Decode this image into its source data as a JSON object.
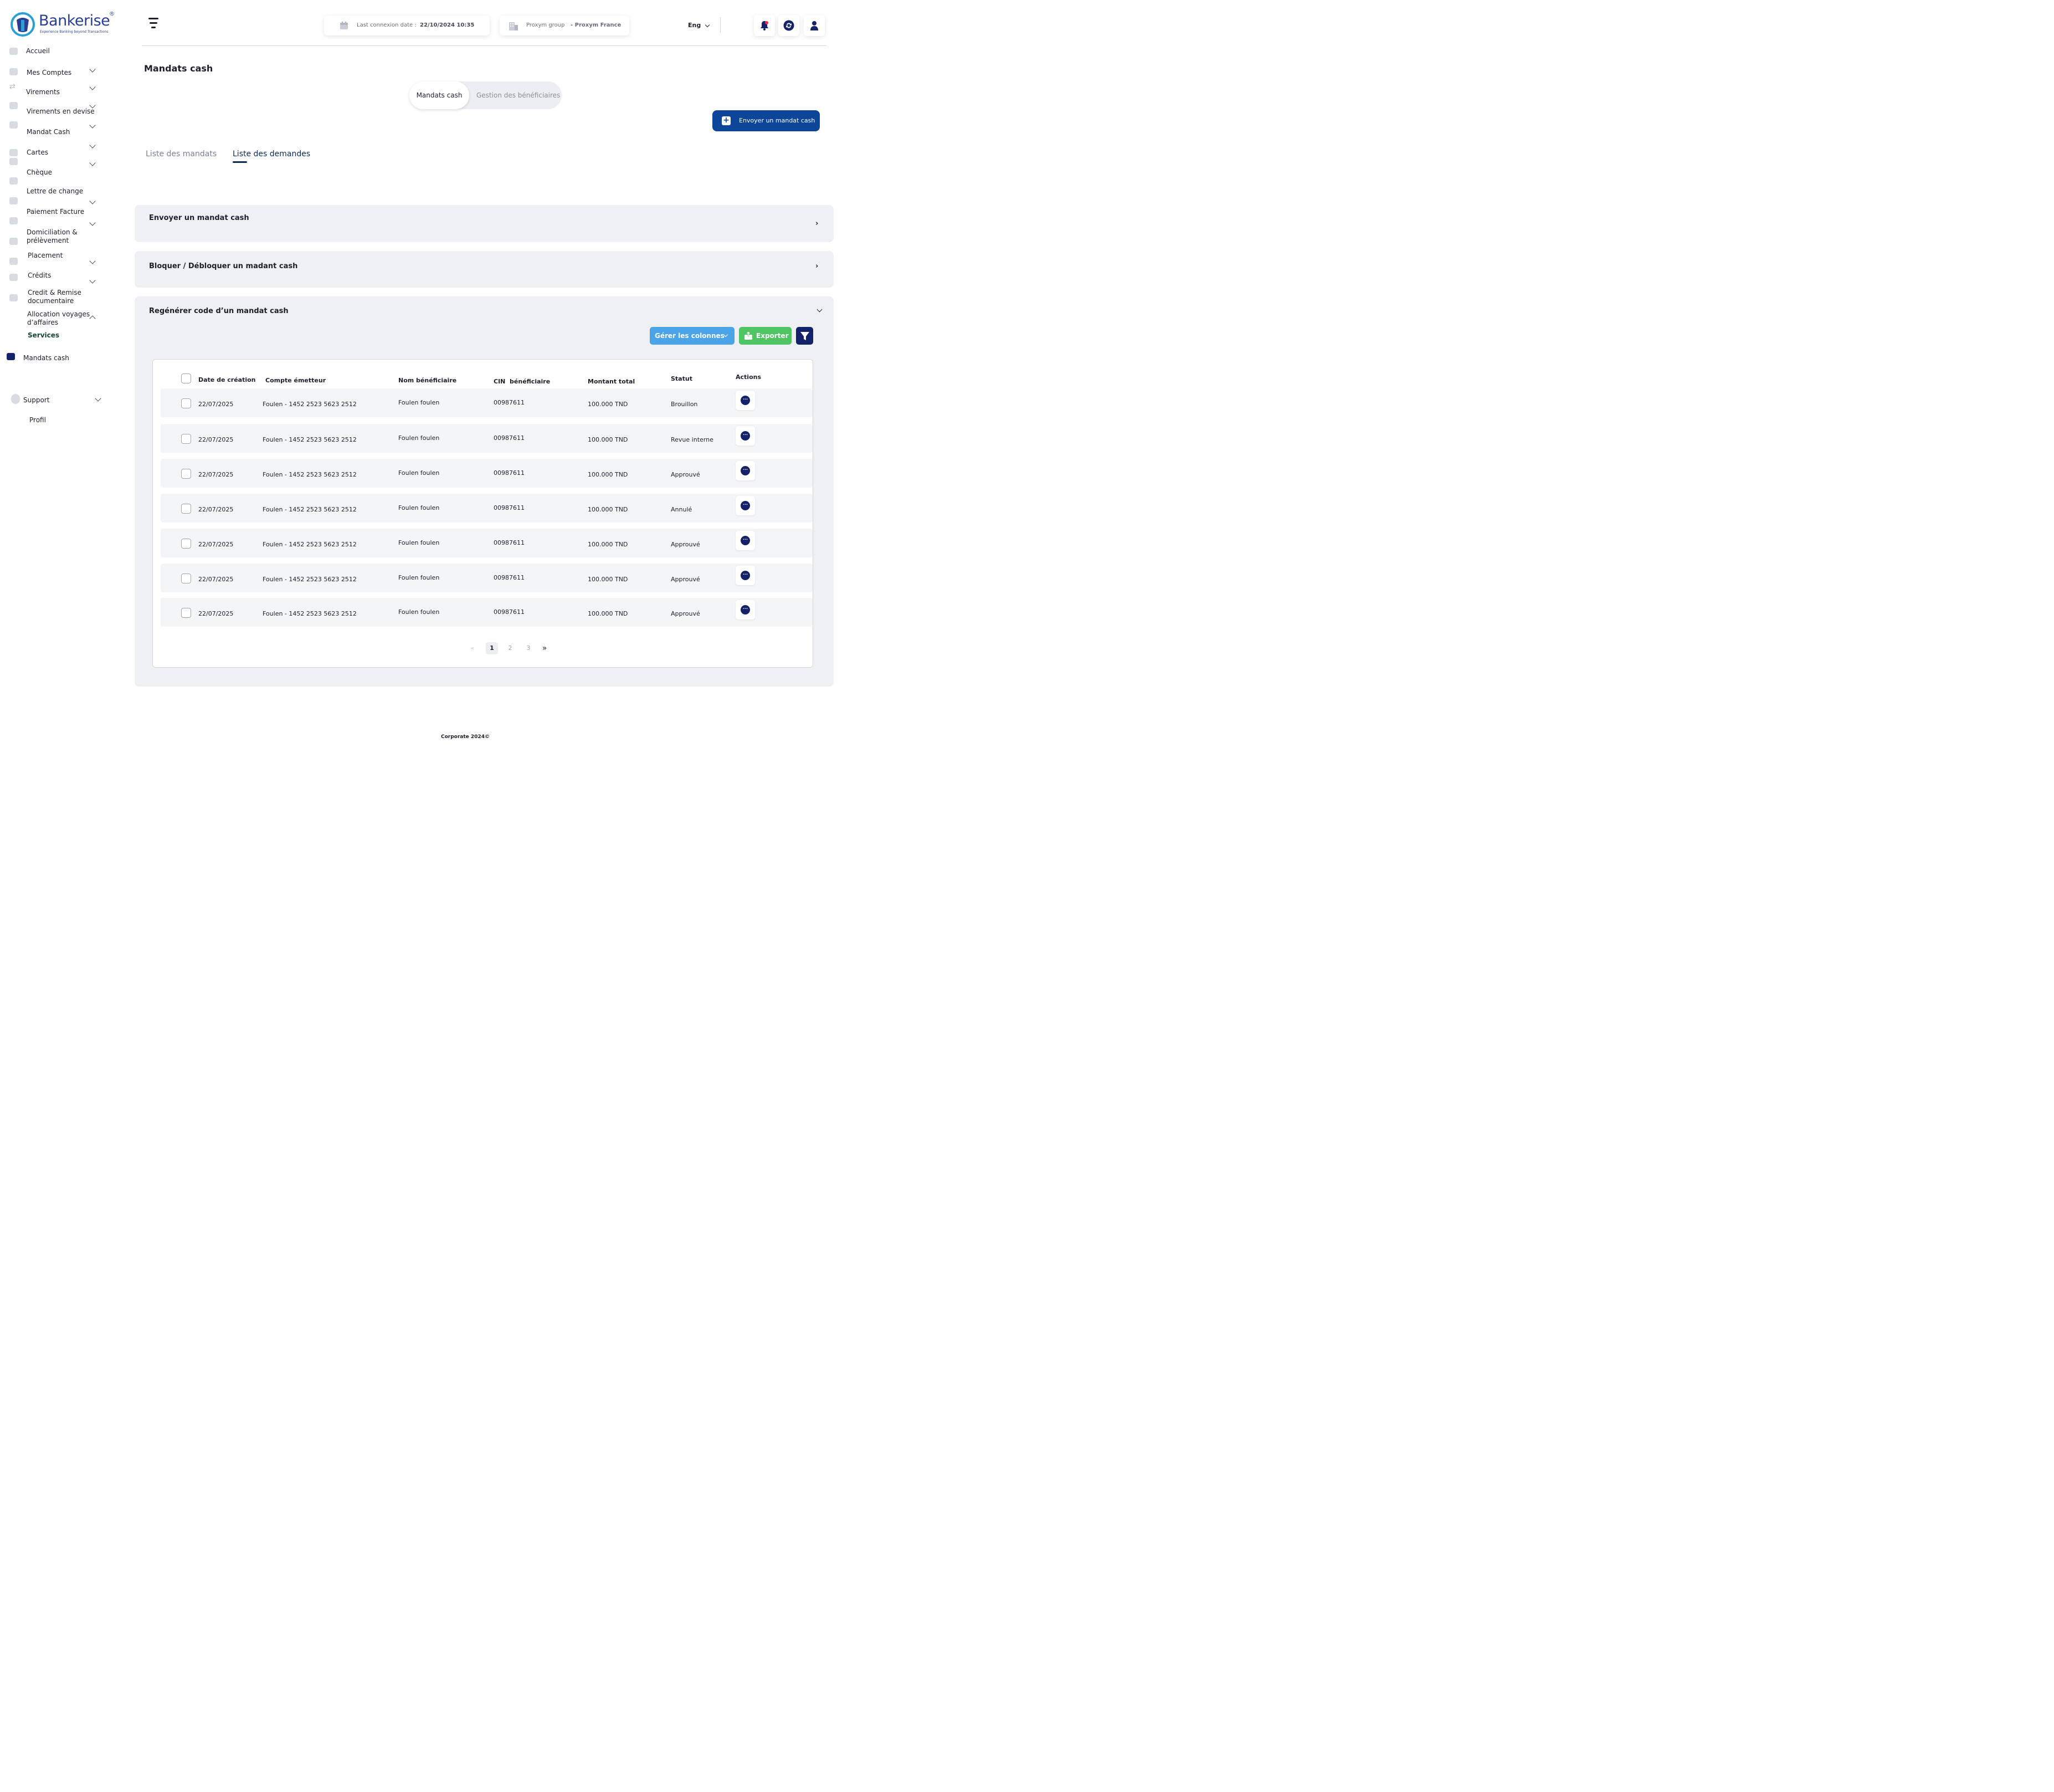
{
  "brand": {
    "name": "Bankerise",
    "tagline": "Experience Banking beyond Transactions",
    "registered": "®"
  },
  "sidebar": {
    "items": [
      {
        "label": "Accueil",
        "icon": "home-icon",
        "chevron": false
      },
      {
        "label": "Mes Comptes",
        "icon": "folder-icon",
        "chevron": true
      },
      {
        "label": "Virements",
        "icon": "transfer-icon",
        "chevron": true
      },
      {
        "label": "Virements en devise",
        "icon": "currency-icon",
        "chevron": true
      },
      {
        "label": "Mandat Cash",
        "icon": "mail-icon",
        "chevron": true
      },
      {
        "label": "Cartes",
        "icon": "card-icon",
        "chevron": true
      },
      {
        "label": "Chèque",
        "icon": "cheque-icon",
        "chevron": true
      },
      {
        "label": "Lettre de change",
        "icon": "mail-icon",
        "chevron": false
      },
      {
        "label": "Paiement Facture",
        "icon": "invoice-icon",
        "chevron": true
      },
      {
        "label": "Domiciliation & prélèvement",
        "icon": "mail-icon",
        "chevron": true
      },
      {
        "label": "Placement",
        "icon": "chart-icon",
        "chevron": true
      },
      {
        "label": "Crédits",
        "icon": "mail-icon",
        "chevron": true
      },
      {
        "label": "Credit & Remise documentaire",
        "icon": "mail-icon",
        "chevron": false
      },
      {
        "label": "Allocation  voyages d’affaires",
        "icon": "mail-icon",
        "chevron": "up"
      }
    ],
    "section_label": "Services",
    "active_item": "Mandats cash",
    "support": "Support",
    "profile": "Profil"
  },
  "header": {
    "last_connexion_label": "Last connexion date :",
    "last_connexion_value": "22/10/2024 10:35",
    "group_label": "Proxym group",
    "group_value": "- Proxym France",
    "language": "Eng"
  },
  "page": {
    "title": "Mandats cash",
    "segment": {
      "active": "Mandats cash",
      "inactive": "Gestion des bénéficiaires"
    },
    "primary_button": "Envoyer un mandat cash",
    "tabs": [
      {
        "label": "Liste des mandats",
        "active": false
      },
      {
        "label": "Liste des demandes",
        "active": true
      }
    ]
  },
  "accordions": [
    {
      "title": "Envoyer un mandat cash",
      "expanded": false
    },
    {
      "title": "Bloquer / Débloquer un madant cash",
      "expanded": false
    },
    {
      "title": "Regénérer code d’un mandat cash",
      "expanded": true
    }
  ],
  "toolbar": {
    "columns_button": "Gérer les colonnes",
    "export_button": "Exporter",
    "filter_icon": "filter-icon"
  },
  "table": {
    "columns": [
      "Date de création",
      "Compte émetteur",
      "Nom bénéficiaire",
      "CIN  bénéficiaire",
      "Montant total",
      "Statut",
      "Actions"
    ],
    "rows": [
      {
        "date": "22/07/2025",
        "compte": "Foulen - 1452 2523 5623 2512",
        "nom": "Foulen foulen",
        "cin": "00987611",
        "montant": "100.000 TND",
        "statut": "Brouillon"
      },
      {
        "date": "22/07/2025",
        "compte": "Foulen - 1452 2523 5623 2512",
        "nom": "Foulen foulen",
        "cin": "00987611",
        "montant": "100.000 TND",
        "statut": "Revue interne"
      },
      {
        "date": "22/07/2025",
        "compte": "Foulen - 1452 2523 5623 2512",
        "nom": "Foulen foulen",
        "cin": "00987611",
        "montant": "100.000 TND",
        "statut": "Approuvé"
      },
      {
        "date": "22/07/2025",
        "compte": "Foulen - 1452 2523 5623 2512",
        "nom": "Foulen foulen",
        "cin": "00987611",
        "montant": "100.000 TND",
        "statut": "Annulé"
      },
      {
        "date": "22/07/2025",
        "compte": "Foulen - 1452 2523 5623 2512",
        "nom": "Foulen foulen",
        "cin": "00987611",
        "montant": "100.000 TND",
        "statut": "Approuvé"
      },
      {
        "date": "22/07/2025",
        "compte": "Foulen - 1452 2523 5623 2512",
        "nom": "Foulen foulen",
        "cin": "00987611",
        "montant": "100.000 TND",
        "statut": "Approuvé"
      },
      {
        "date": "22/07/2025",
        "compte": "Foulen - 1452 2523 5623 2512",
        "nom": "Foulen foulen",
        "cin": "00987611",
        "montant": "100.000 TND",
        "statut": "Approuvé"
      }
    ]
  },
  "pagination": {
    "first": "«",
    "pages": [
      "1",
      "2",
      "3"
    ],
    "current": "1",
    "next": "»"
  },
  "footer": "Corporate 2024©",
  "colors": {
    "primary": "#0d4699",
    "navy": "#14226b",
    "columns_btn": "#4ba4e8",
    "export_btn": "#4ec463",
    "filter_btn": "#14226b",
    "notification": "#e5304a"
  }
}
